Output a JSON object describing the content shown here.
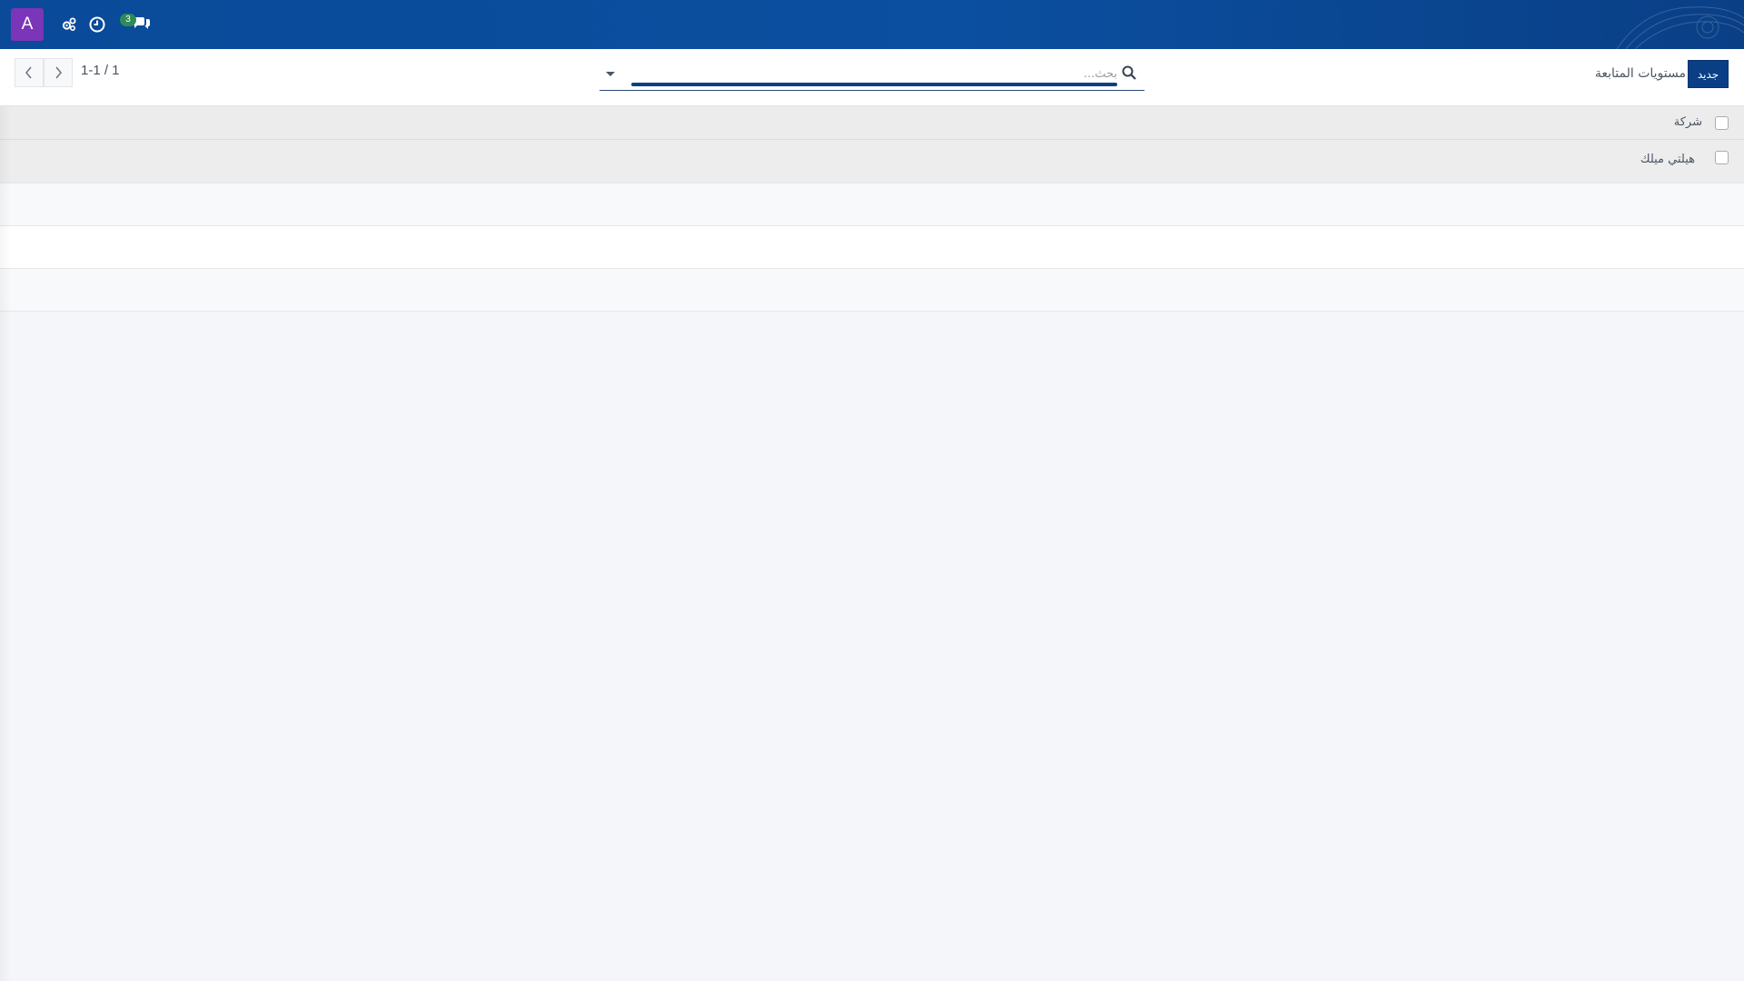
{
  "navbar": {
    "avatar_letter": "A",
    "icons": [
      "settings-gear-icon",
      "activity-clock-icon",
      "discuss-chat-icon"
    ],
    "messages_badge": "3",
    "background_color": "#0b4fa0"
  },
  "control_panel": {
    "title": "مستويات المتابعة",
    "new_button_label": "جديد",
    "search_placeholder": "بحث...",
    "pager": {
      "value": "1-1 / 1"
    },
    "accent_color": "#0a3f86"
  },
  "list": {
    "header_label": "شركة",
    "rows": [
      {
        "name": "هيلتي ميلك"
      }
    ]
  }
}
